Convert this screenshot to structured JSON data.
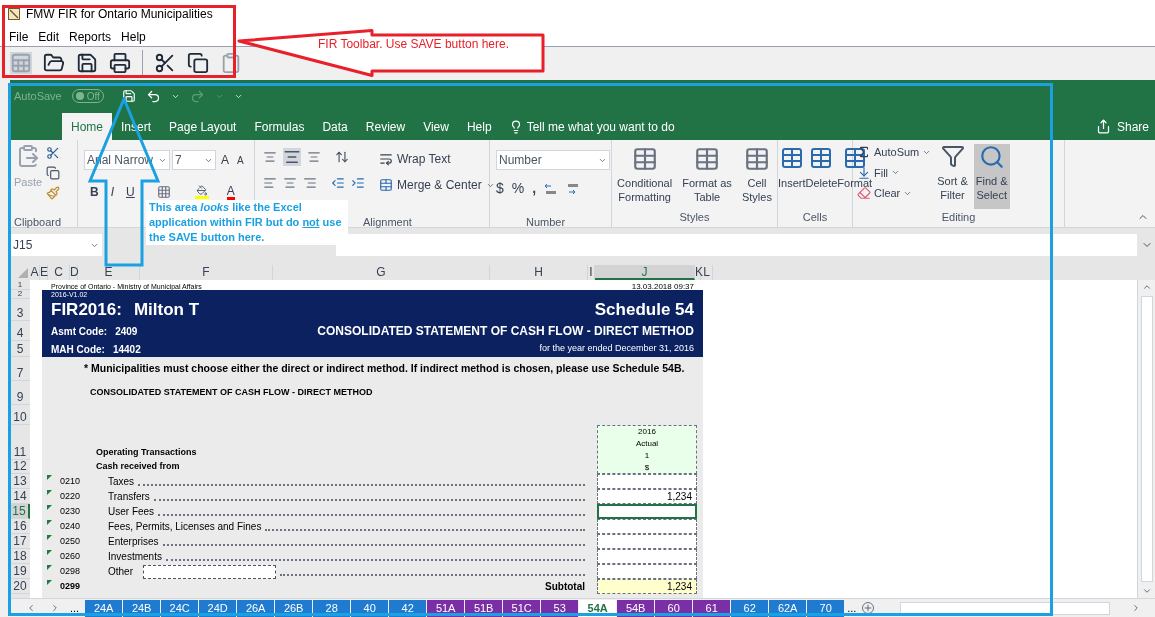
{
  "fir_window": {
    "title": "FMW FIR for Ontario Municipalities",
    "menu": [
      "File",
      "Edit",
      "Reports",
      "Help"
    ],
    "toolbar": [
      {
        "kind": "spreadsheet",
        "disabled": true
      },
      {
        "kind": "open",
        "disabled": false
      },
      {
        "kind": "save",
        "disabled": false
      },
      {
        "kind": "print",
        "disabled": false
      },
      {
        "kind": "cut",
        "disabled": false
      },
      {
        "kind": "copy",
        "disabled": false
      },
      {
        "kind": "paste",
        "disabled": true
      }
    ]
  },
  "callouts": [
    {
      "kind": "toolbar",
      "text": "FIR Toolbar. Use SAVE button here."
    },
    {
      "kind": "excel",
      "before": "This area *looks* like the Excel application within FIR but do ",
      "underlined": "not",
      "after": " use the SAVE button here."
    }
  ],
  "excel": {
    "autosave": {
      "label": "AutoSave",
      "toggle": "Off",
      "on": false
    },
    "tabs": [
      {
        "label": "Home",
        "selected": true
      },
      {
        "label": "Insert",
        "selected": false
      },
      {
        "label": "Page Layout",
        "selected": false
      },
      {
        "label": "Formulas",
        "selected": false
      },
      {
        "label": "Data",
        "selected": false
      },
      {
        "label": "Review",
        "selected": false
      },
      {
        "label": "View",
        "selected": false
      },
      {
        "label": "Help",
        "selected": false
      }
    ],
    "tell_me": "Tell me what you want to do",
    "share": "Share",
    "ribbon": {
      "clipboard": {
        "paste": "Paste",
        "label": "Clipboard"
      },
      "font": {
        "name": "Arial Narrow",
        "size": "7",
        "grow": "A",
        "shrink": "A",
        "bold": "B",
        "italic": "I",
        "underline": "U",
        "color_letter": "A"
      },
      "alignment": {
        "wrap": "Wrap Text",
        "merge": "Merge & Center",
        "label": "Alignment"
      },
      "number": {
        "format": "Number",
        "currency": "$",
        "percent": "%",
        "comma": ",",
        "label": "Number"
      },
      "styles": {
        "items": [
          [
            "Conditional",
            "Formatting"
          ],
          [
            "Format as",
            "Table"
          ],
          [
            "Cell",
            "Styles"
          ]
        ],
        "label": "Styles"
      },
      "cells": {
        "items": [
          "Insert",
          "Delete",
          "Format"
        ],
        "label": "Cells"
      },
      "editing": {
        "autosum": "AutoSum",
        "fill": "Fill",
        "clear": "Clear",
        "sort": [
          "Sort &",
          "Filter"
        ],
        "find": [
          "Find &",
          "Select"
        ],
        "find_highlighted": true,
        "label": "Editing"
      }
    },
    "name_box": "J15",
    "columns": [
      {
        "label": "A",
        "selected": false
      },
      {
        "label": "E",
        "selected": false
      },
      {
        "label": "C",
        "selected": false
      },
      {
        "label": "D",
        "selected": false
      },
      {
        "label": "E",
        "selected": false
      },
      {
        "label": "F",
        "selected": false
      },
      {
        "label": "G",
        "selected": false
      },
      {
        "label": "H",
        "selected": false
      },
      {
        "label": "I",
        "selected": false
      },
      {
        "label": "J",
        "selected": true
      },
      {
        "label": "K",
        "selected": false
      },
      {
        "label": "L",
        "selected": false
      }
    ],
    "row_numbers": [
      {
        "label": "1",
        "selected": false
      },
      {
        "label": "2",
        "selected": false
      },
      {
        "label": "3",
        "selected": false
      },
      {
        "label": "4",
        "selected": false
      },
      {
        "label": "5",
        "selected": false
      },
      {
        "label": "7",
        "selected": false
      },
      {
        "label": "9",
        "selected": false
      },
      {
        "label": "10",
        "selected": false
      },
      {
        "label": "11",
        "selected": false
      },
      {
        "label": "12",
        "selected": false
      },
      {
        "label": "13",
        "selected": false
      },
      {
        "label": "14",
        "selected": false
      },
      {
        "label": "15",
        "selected": true
      },
      {
        "label": "16",
        "selected": false
      },
      {
        "label": "17",
        "selected": false
      },
      {
        "label": "18",
        "selected": false
      },
      {
        "label": "19",
        "selected": false
      },
      {
        "label": "20",
        "selected": false
      }
    ],
    "sheet": {
      "province": "Province of Ontario  -  Ministry of Municipal Affairs",
      "timestamp": "13.03.2018 09:37",
      "version": "2016-V1.02",
      "fir": "FIR2016:",
      "municipality": "Milton T",
      "schedule": "Schedule 54",
      "asmt_label": "Asmt Code:",
      "asmt": "2409",
      "mah_label": "MAH Code:",
      "mah": "14402",
      "statement": "CONSOLIDATED STATEMENT OF CASH FLOW - DIRECT METHOD",
      "year": "for the year ended December 31, 2016",
      "note": "* Municipalities must choose either the direct or indirect method.  If indirect method is chosen, please use Schedule 54B.",
      "subtitle": "CONSOLIDATED STATEMENT OF CASH FLOW - DIRECT METHOD",
      "column_head": [
        "2016",
        "Actual",
        "1",
        "$"
      ],
      "section": "Operating Transactions",
      "subsection": "Cash received from",
      "rows": [
        {
          "kind": "item",
          "code": "0210",
          "label": "Taxes",
          "value": "",
          "selected": false
        },
        {
          "kind": "item",
          "code": "0220",
          "label": "Transfers",
          "value": "1,234",
          "selected": false
        },
        {
          "kind": "item",
          "code": "0230",
          "label": "User Fees",
          "value": "",
          "selected": true
        },
        {
          "kind": "item",
          "code": "0240",
          "label": "Fees, Permits, Licenses and Fines",
          "value": "",
          "selected": false
        },
        {
          "kind": "item",
          "code": "0250",
          "label": "Enterprises",
          "value": "",
          "selected": false
        },
        {
          "kind": "item",
          "code": "0260",
          "label": "Investments",
          "value": "",
          "selected": false
        },
        {
          "kind": "other",
          "code": "0298",
          "label": "Other",
          "value": "",
          "selected": false
        },
        {
          "kind": "subtotal",
          "code": "0299",
          "label": "Subtotal",
          "value": "1,234",
          "selected": false
        }
      ]
    },
    "sheet_tabs": [
      {
        "label": "24A",
        "color": "#1e7bd0",
        "selected": false
      },
      {
        "label": "24B",
        "color": "#1e7bd0",
        "selected": false
      },
      {
        "label": "24C",
        "color": "#1e7bd0",
        "selected": false
      },
      {
        "label": "24D",
        "color": "#1e7bd0",
        "selected": false
      },
      {
        "label": "26A",
        "color": "#1e7bd0",
        "selected": false
      },
      {
        "label": "26B",
        "color": "#1e7bd0",
        "selected": false
      },
      {
        "label": "28",
        "color": "#1e7bd0",
        "selected": false
      },
      {
        "label": "40",
        "color": "#1e7bd0",
        "selected": false
      },
      {
        "label": "42",
        "color": "#1e7bd0",
        "selected": false
      },
      {
        "label": "51A",
        "color": "#7b2fa6",
        "selected": false
      },
      {
        "label": "51B",
        "color": "#7b2fa6",
        "selected": false
      },
      {
        "label": "51C",
        "color": "#7b2fa6",
        "selected": false
      },
      {
        "label": "53",
        "color": "#7b2fa6",
        "selected": false
      },
      {
        "label": "54A",
        "color": "#ffffff",
        "selected": true
      },
      {
        "label": "54B",
        "color": "#7b2fa6",
        "selected": false
      },
      {
        "label": "60",
        "color": "#7b2fa6",
        "selected": false
      },
      {
        "label": "61",
        "color": "#7b2fa6",
        "selected": false
      },
      {
        "label": "62",
        "color": "#1e7bd0",
        "selected": false
      },
      {
        "label": "62A",
        "color": "#1e7bd0",
        "selected": false
      },
      {
        "label": "70",
        "color": "#1e7bd0",
        "selected": false
      }
    ],
    "tabs_more": [
      "...",
      "..."
    ]
  }
}
